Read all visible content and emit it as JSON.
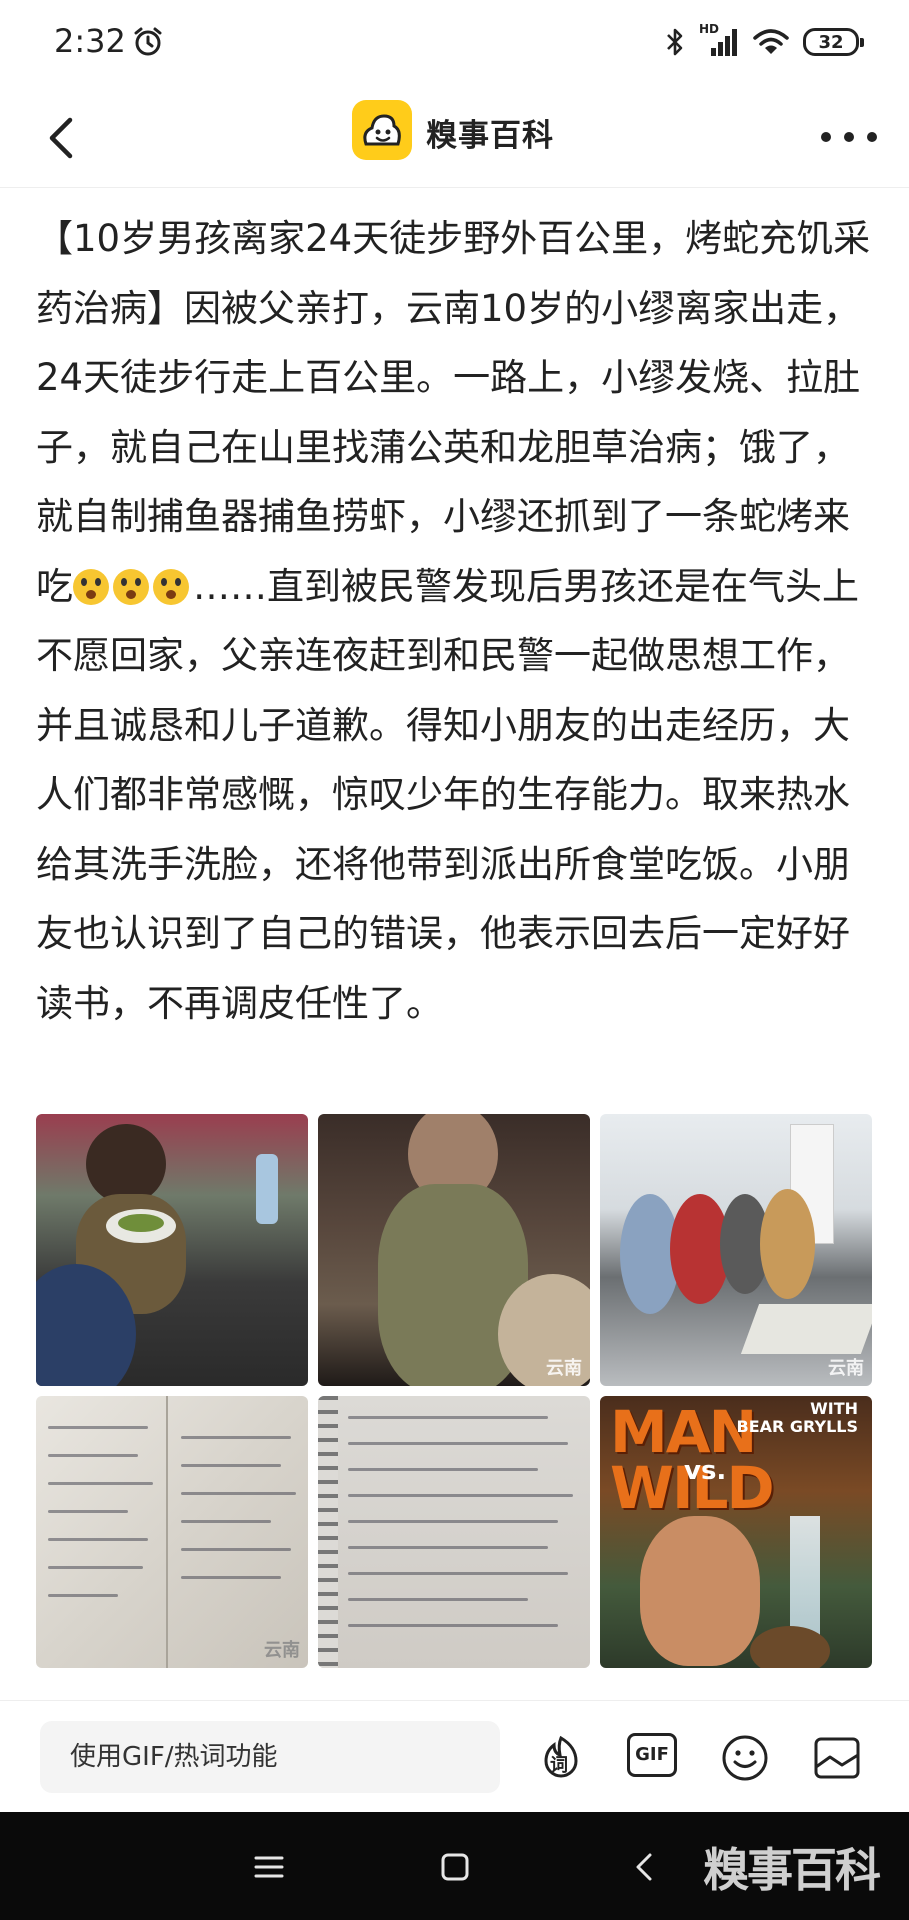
{
  "status_bar": {
    "time": "2:32",
    "network_tag": "HD",
    "battery": "32"
  },
  "nav": {
    "title": "糗事百科"
  },
  "post": {
    "text_before_emoji": "【10岁男孩离家24天徒步野外百公里，烤蛇充饥采药治病】因被父亲打，云南10岁的小缪离家出走，24天徒步行走上百公里。一路上，小缪发烧、拉肚子，就自己在山里找蒲公英和龙胆草治病；饿了，就自制捕鱼器捕鱼捞虾，小缪还抓到了一条蛇烤来吃",
    "text_after_emoji": "……直到被民警发现后男孩还是在气头上不愿回家，父亲连夜赶到和民警一起做思想工作，并且诚恳和儿子道歉。得知小朋友的出走经历，大人们都非常感慨，惊叹少年的生存能力。取来热水给其洗手洗脸，还将他带到派出所食堂吃饭。小朋友也认识到了自己的错误，他表示回去后一定好好读书，不再调皮任性了。"
  },
  "images": {
    "man_vs_wild_title_1": "MAN",
    "man_vs_wild_vs": "vs.",
    "man_vs_wild_title_2": "WILD",
    "man_vs_wild_with": "WITH",
    "man_vs_wild_host": "BEAR GRYLLS",
    "watermark": "云南"
  },
  "composer": {
    "placeholder": "使用GIF/热词功能",
    "hotword_label": "词",
    "gif_label": "GIF"
  },
  "system_nav": {
    "watermark": "糗事百科"
  },
  "colors": {
    "logo_yellow": "#ffcc1a",
    "text": "#222222",
    "sysnav_bg": "#0a0a0a"
  }
}
